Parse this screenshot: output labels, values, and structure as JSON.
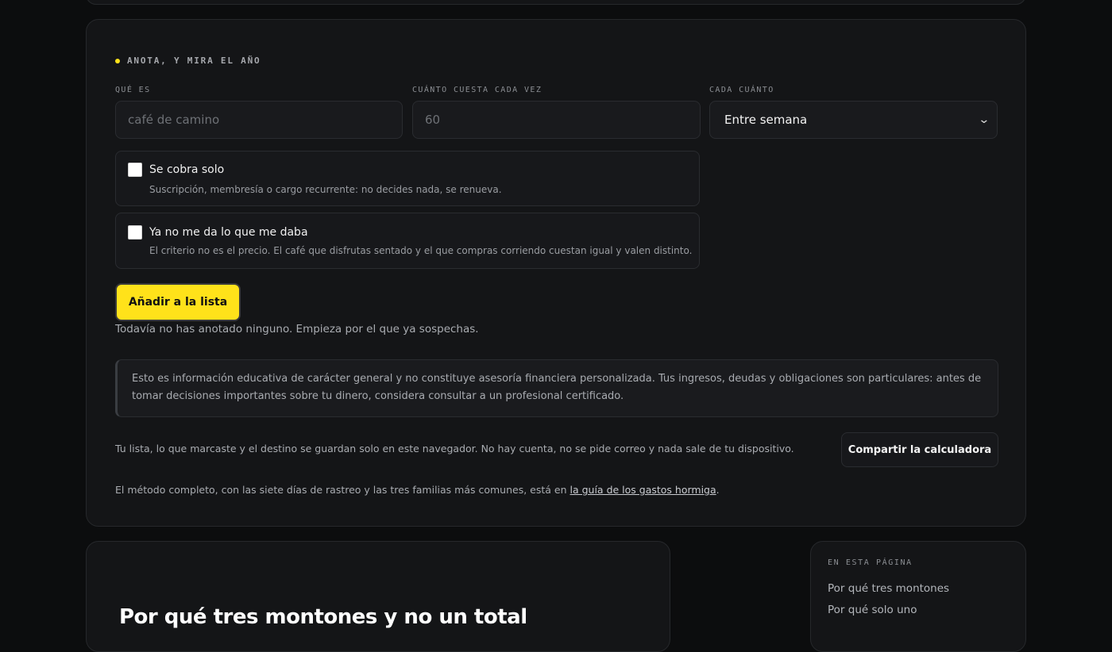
{
  "calculator": {
    "kicker": "ANOTA, Y MIRA EL AÑO",
    "fields": {
      "what": {
        "label": "QUÉ ES",
        "placeholder": "café de camino",
        "value": ""
      },
      "cost": {
        "label": "CUÁNTO CUESTA CADA VEZ",
        "placeholder": "60",
        "value": ""
      },
      "frequency": {
        "label": "CADA CUÁNTO",
        "selected": "Entre semana"
      }
    },
    "checks": [
      {
        "title": "Se cobra solo",
        "description": "Suscripción, membresía o cargo recurrente: no decides nada, se renueva.",
        "checked": false
      },
      {
        "title": "Ya no me da lo que me daba",
        "description": "El criterio no es el precio. El café que disfrutas sentado y el que compras corriendo cuestan igual y valen distinto.",
        "checked": false
      }
    ],
    "add_button": "Añadir a la lista",
    "empty_note": "Todavía no has anotado ninguno. Empieza por el que ya sospechas.",
    "disclaimer": "Esto es información educativa de carácter general y no constituye asesoría financiera personalizada. Tus ingresos, deudas y obligaciones son particulares: antes de tomar decisiones importantes sobre tu dinero, considera consultar a un profesional certificado.",
    "privacy_note": "Tu lista, lo que marcaste y el destino se guardan solo en este navegador. No hay cuenta, no se pide correo y nada sale de tu dispositivo.",
    "share_button": "Compartir la calculadora",
    "method": {
      "prefix": "El método completo, con las siete días de rastreo y las tres familias más comunes, está en ",
      "link": "la guía de los gastos hormiga",
      "suffix": "."
    }
  },
  "article": {
    "title": "Por qué tres montones y no un total"
  },
  "toc": {
    "label": "EN ESTA PÁGINA",
    "items": [
      "Por qué tres montones",
      "Por qué solo uno"
    ]
  },
  "colors": {
    "accent": "#ffe21a",
    "background": "#0c0d0e",
    "card": "#141517"
  },
  "icons": {
    "select": "chevron-down-icon",
    "kicker": "dot-icon"
  }
}
